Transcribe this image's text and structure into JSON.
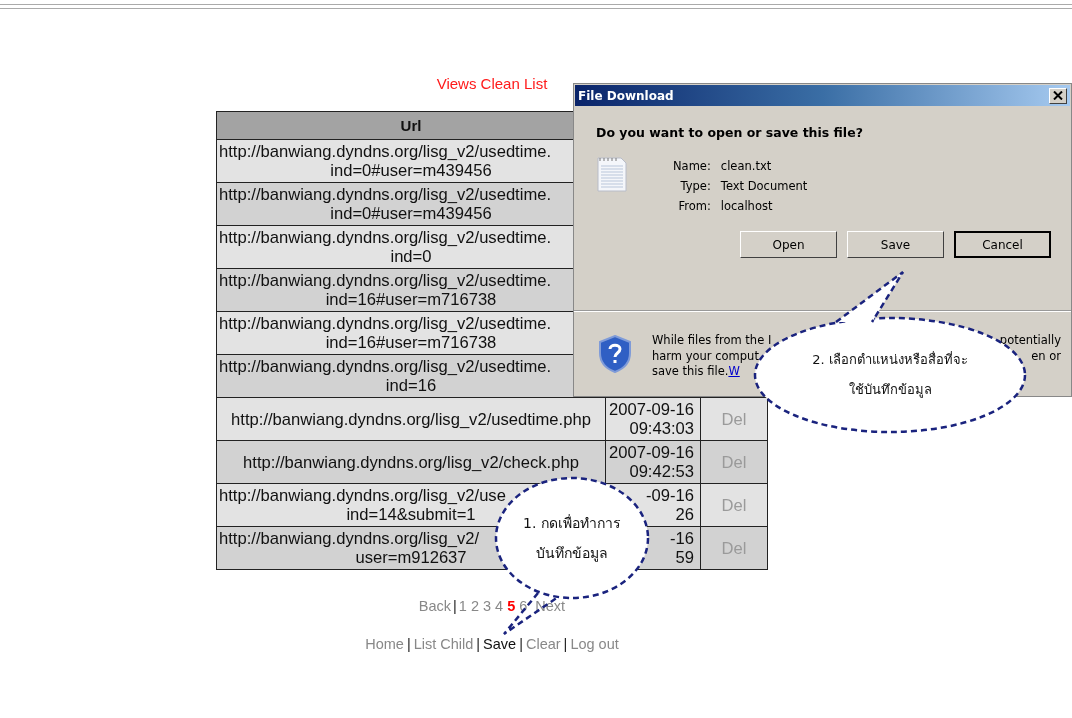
{
  "page_title": "Views Clean List",
  "table": {
    "columns": [
      "Url"
    ],
    "rows": [
      {
        "url": [
          "http://banwiang.dyndns.org/lisg_v2/usedtime.",
          "ind=0#user=m439456"
        ]
      },
      {
        "url": [
          "http://banwiang.dyndns.org/lisg_v2/usedtime.",
          "ind=0#user=m439456"
        ]
      },
      {
        "url": [
          "http://banwiang.dyndns.org/lisg_v2/usedtime.",
          "ind=0"
        ]
      },
      {
        "url": [
          "http://banwiang.dyndns.org/lisg_v2/usedtime.",
          "ind=16#user=m716738"
        ]
      },
      {
        "url": [
          "http://banwiang.dyndns.org/lisg_v2/usedtime.",
          "ind=16#user=m716738"
        ]
      },
      {
        "url": [
          "http://banwiang.dyndns.org/lisg_v2/usedtime.",
          "ind=16"
        ]
      },
      {
        "url": [
          "http://banwiang.dyndns.org/lisg_v2/usedtime.php"
        ],
        "time": [
          "2007-09-16",
          "09:43:03"
        ],
        "action": "Del"
      },
      {
        "url": [
          "http://banwiang.dyndns.org/lisg_v2/check.php"
        ],
        "time": [
          "2007-09-16",
          "09:42:53"
        ],
        "action": "Del"
      },
      {
        "url": [
          "http://banwiang.dyndns.org/lisg_v2/use",
          "ind=14&submit=1"
        ],
        "time": [
          "-09-16",
          "26"
        ],
        "action": "Del"
      },
      {
        "url": [
          "http://banwiang.dyndns.org/lisg_v2/",
          "user=m912637"
        ],
        "time": [
          "-16",
          "59"
        ],
        "action": "Del"
      }
    ]
  },
  "pagination": {
    "back": "Back",
    "separator": "|",
    "pages": [
      {
        "label": "1",
        "selected": false
      },
      {
        "label": "2",
        "selected": false
      },
      {
        "label": "3",
        "selected": false
      },
      {
        "label": "4",
        "selected": false
      },
      {
        "label": "5",
        "selected": true
      },
      {
        "label": "6",
        "selected": false
      }
    ],
    "next": "Next"
  },
  "nav": {
    "separator": "|",
    "items": [
      {
        "label": "Home",
        "selected": false
      },
      {
        "label": "List Child",
        "selected": false
      },
      {
        "label": "Save",
        "selected": true
      },
      {
        "label": "Clear",
        "selected": false
      },
      {
        "label": "Log out",
        "selected": false
      }
    ]
  },
  "dialog": {
    "title": "File Download",
    "question": "Do you want to open or save this file?",
    "fields": [
      {
        "label": "Name:",
        "value": "clean.txt"
      },
      {
        "label": "Type:",
        "value": "Text Document"
      },
      {
        "label": "From:",
        "value": "localhost"
      }
    ],
    "buttons": [
      {
        "label": "Open",
        "default": false
      },
      {
        "label": "Save",
        "default": false
      },
      {
        "label": "Cancel",
        "default": true
      }
    ],
    "warning": {
      "left": [
        "While files from the I",
        "harm your comput",
        "save this file."
      ],
      "link": "W",
      "right": [
        "potentially",
        "en or"
      ]
    }
  },
  "callouts": [
    {
      "lines": [
        "2. เลือกตำแหน่งหรือสื่อที่จะ",
        "ใช้บันทึกข้อมูล"
      ]
    },
    {
      "lines": [
        "1. กดเพื่อทำการ",
        "บันทึกข้อมูล"
      ]
    }
  ]
}
